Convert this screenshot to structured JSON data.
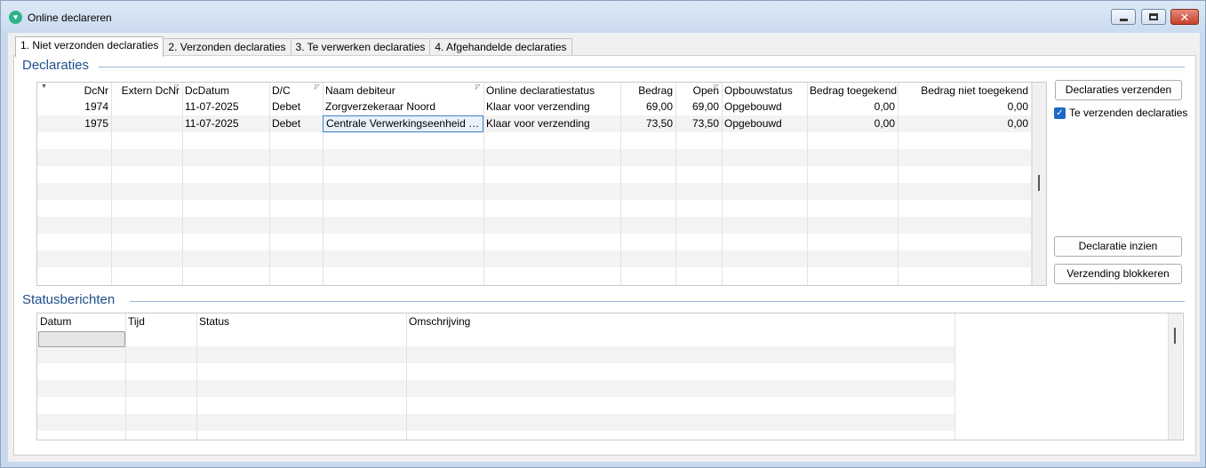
{
  "window": {
    "title": "Online declareren"
  },
  "tabs": [
    {
      "label": "1. Niet verzonden declaraties",
      "active": true
    },
    {
      "label": "2. Verzonden declaraties",
      "active": false
    },
    {
      "label": "3. Te verwerken declaraties",
      "active": false
    },
    {
      "label": "4. Afgehandelde declaraties",
      "active": false
    }
  ],
  "declaraties": {
    "title": "Declaraties",
    "columns": [
      "DcNr",
      "Extern DcNr",
      "DcDatum",
      "D/C",
      "Naam debiteur",
      "Online declaratiestatus",
      "Bedrag",
      "Open",
      "Opbouwstatus",
      "Bedrag toegekend",
      "Bedrag niet toegekend"
    ],
    "rows": [
      [
        "1974",
        "",
        "11-07-2025",
        "Debet",
        "Zorgverzekeraar Noord",
        "Klaar voor verzending",
        "69,00",
        "69,00",
        "Opgebouwd",
        "0,00",
        "0,00"
      ],
      [
        "1975",
        "",
        "11-07-2025",
        "Debet",
        "Centrale Verwerkingseenheid C...",
        "Klaar voor verzending",
        "73,50",
        "73,50",
        "Opgebouwd",
        "0,00",
        "0,00"
      ]
    ],
    "selected_cell": {
      "row": 1,
      "col": 4
    }
  },
  "side": {
    "send_button": "Declaraties verzenden",
    "checkbox_label": "Te verzenden declaraties",
    "checkbox_checked": true,
    "view_button": "Declaratie inzien",
    "block_button": "Verzending blokkeren"
  },
  "status": {
    "title": "Statusberichten",
    "columns": [
      "Datum",
      "Tijd",
      "Status",
      "Omschrijving"
    ]
  },
  "icons": {
    "app": "heart-shield-icon",
    "minimize": "minimize-icon",
    "maximize": "maximize-icon",
    "close": "close-icon",
    "check": "checkmark-icon"
  },
  "colors": {
    "accent": "#1f4e8c",
    "checkbox": "#1f68c4",
    "close": "#c7402a"
  }
}
